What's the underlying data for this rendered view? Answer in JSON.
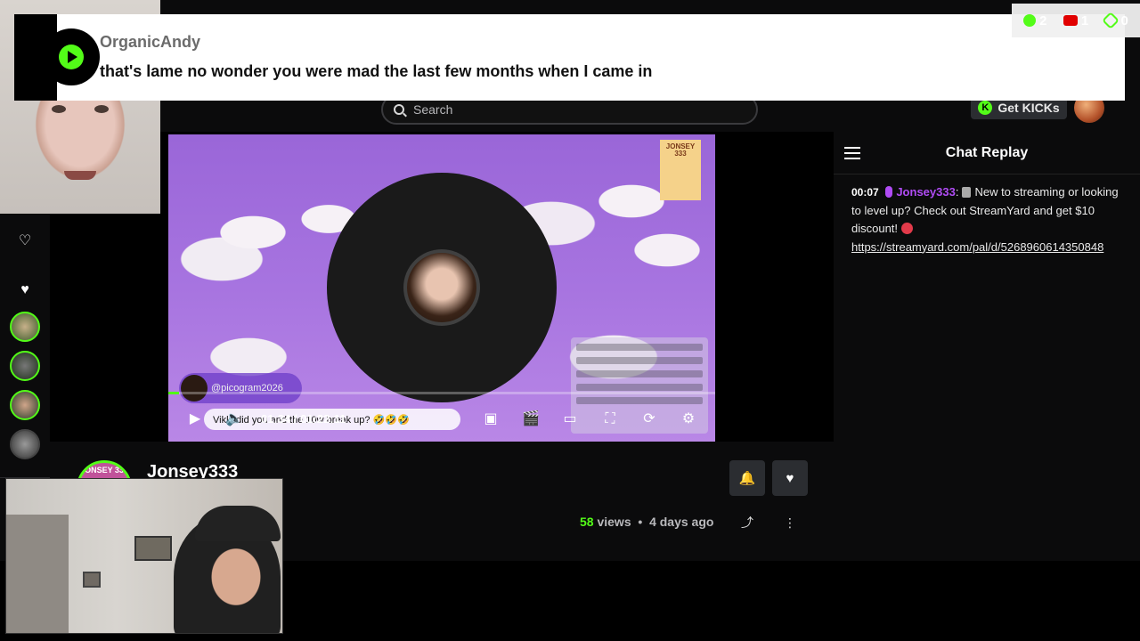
{
  "toast": {
    "author": "OrganicAndy",
    "message": "that's lame no wonder you were mad the last few months when I came in"
  },
  "counters": {
    "kick": "2",
    "youtube": "1",
    "links": "0"
  },
  "header": {
    "search_placeholder": "Search",
    "get_kicks_label": "Get KICKs"
  },
  "player": {
    "time_display": "01:34 / 01:22:11",
    "progress_fraction": 0.019,
    "overlay_tag": "@picogram2026",
    "overlay_caption": "Vikki did you and the 10w break up? 🤣🤣🤣",
    "logo_text": "JONSEY 333"
  },
  "chat": {
    "title": "Chat Replay",
    "messages": [
      {
        "timestamp": "00:07",
        "username": "Jonsey333",
        "text": "New to streaming or looking to level up? Check out StreamYard and get $10 discount!",
        "link": "https://streamyard.com/pal/d/5268960614350848"
      }
    ]
  },
  "channel": {
    "name": "Jonsey333",
    "avatar_text": "JONSEY 333",
    "views_count": "58",
    "views_label": "views",
    "age": "4 days ago"
  },
  "icons": {
    "search": "search-icon",
    "notify": "bell-icon",
    "follow": "heart-icon",
    "share": "share-icon",
    "more": "more-vertical-icon"
  },
  "colors": {
    "accent": "#53fc18",
    "username": "#b04cf5"
  }
}
